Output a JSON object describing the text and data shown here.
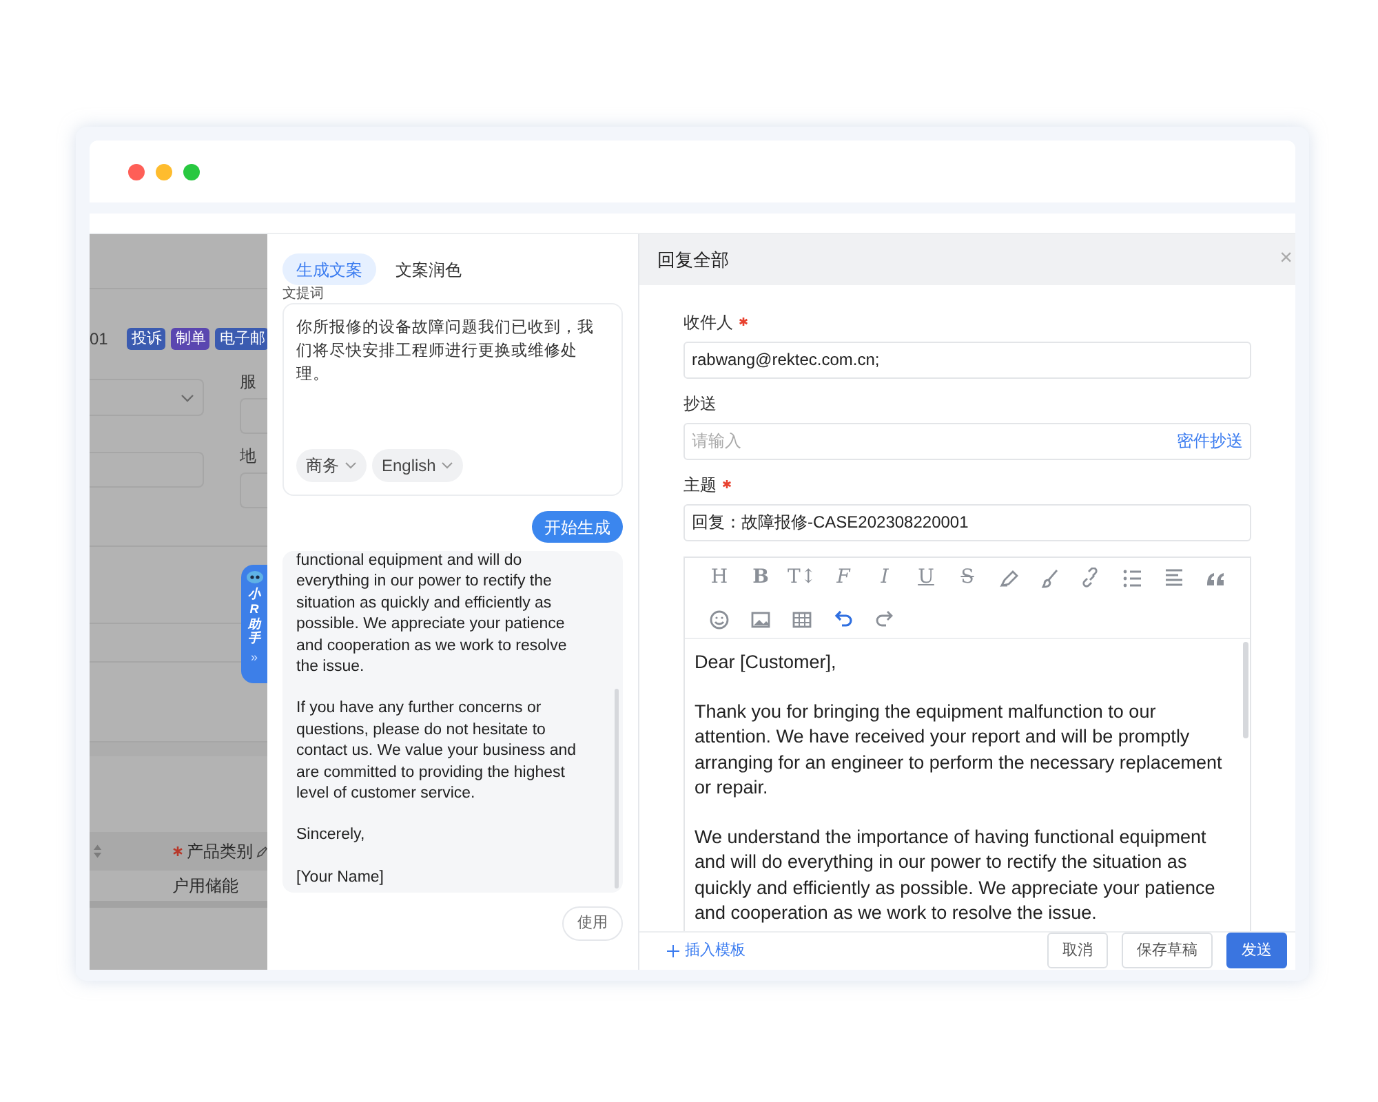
{
  "window": {
    "controls": [
      {
        "color": "#fe5f57"
      },
      {
        "color": "#febc2e"
      },
      {
        "color": "#28c840"
      }
    ]
  },
  "background_page": {
    "case_suffix": "01",
    "tags": [
      {
        "label": "投诉",
        "color": "#3b5bb0"
      },
      {
        "label": "制单",
        "color": "#5a46b0"
      },
      {
        "label": "电子邮",
        "color": "#3b5bb0"
      }
    ],
    "labels": [
      "服",
      "地"
    ],
    "assistant_tab": {
      "label": "小R助手",
      "arrow": "»"
    },
    "table": {
      "columns": [
        {
          "label": "产品类别",
          "required": true
        }
      ],
      "rows": [
        [
          "户用储能"
        ]
      ]
    }
  },
  "ai_panel": {
    "tabs": [
      {
        "label": "生成文案",
        "selected": true
      },
      {
        "label": "文案润色",
        "selected": false
      }
    ],
    "prompt_label": "文提词",
    "prompt": "你所报修的设备故障问题我们已收到，我们将尽快安排工程师进行更换或维修处理。",
    "options": [
      "商务",
      "English"
    ],
    "generate_button": "开始生成",
    "result": [
      "functional equipment and will do everything in our power to rectify the situation as quickly and efficiently as possible. We appreciate your patience and cooperation as we work to resolve the issue.",
      "If you have any further concerns or questions, please do not hesitate to contact us. We value your business and are committed to providing the highest level of customer service.",
      "Sincerely,",
      "[Your Name]"
    ],
    "use_button": "使用"
  },
  "reply": {
    "title": "回复全部",
    "close": "×",
    "fields": [
      {
        "label": "收件人",
        "required": true,
        "value": "rabwang@rektec.com.cn;"
      },
      {
        "label": "抄送",
        "placeholder": "请输入",
        "action": "密件抄送"
      },
      {
        "label": "主题",
        "required": true,
        "value": "回复：故障报修-CASE202308220001"
      }
    ],
    "toolbar_glyphs": [
      "H",
      "B",
      "T↕",
      "F",
      "I",
      "U",
      "S"
    ],
    "body": [
      "Dear [Customer],",
      "Thank you for bringing the equipment malfunction to our attention. We have received your report and will be promptly arranging for an engineer to perform the necessary replacement or repair.",
      "We understand the importance of having functional equipment and will do everything in our power to rectify the situation as quickly and efficiently as possible. We appreciate your patience and cooperation as we work to resolve the issue."
    ],
    "insert_template": "插入模板",
    "buttons": [
      {
        "label": "取消",
        "kind": "default"
      },
      {
        "label": "保存草稿",
        "kind": "default"
      },
      {
        "label": "发送",
        "kind": "primary"
      }
    ]
  }
}
